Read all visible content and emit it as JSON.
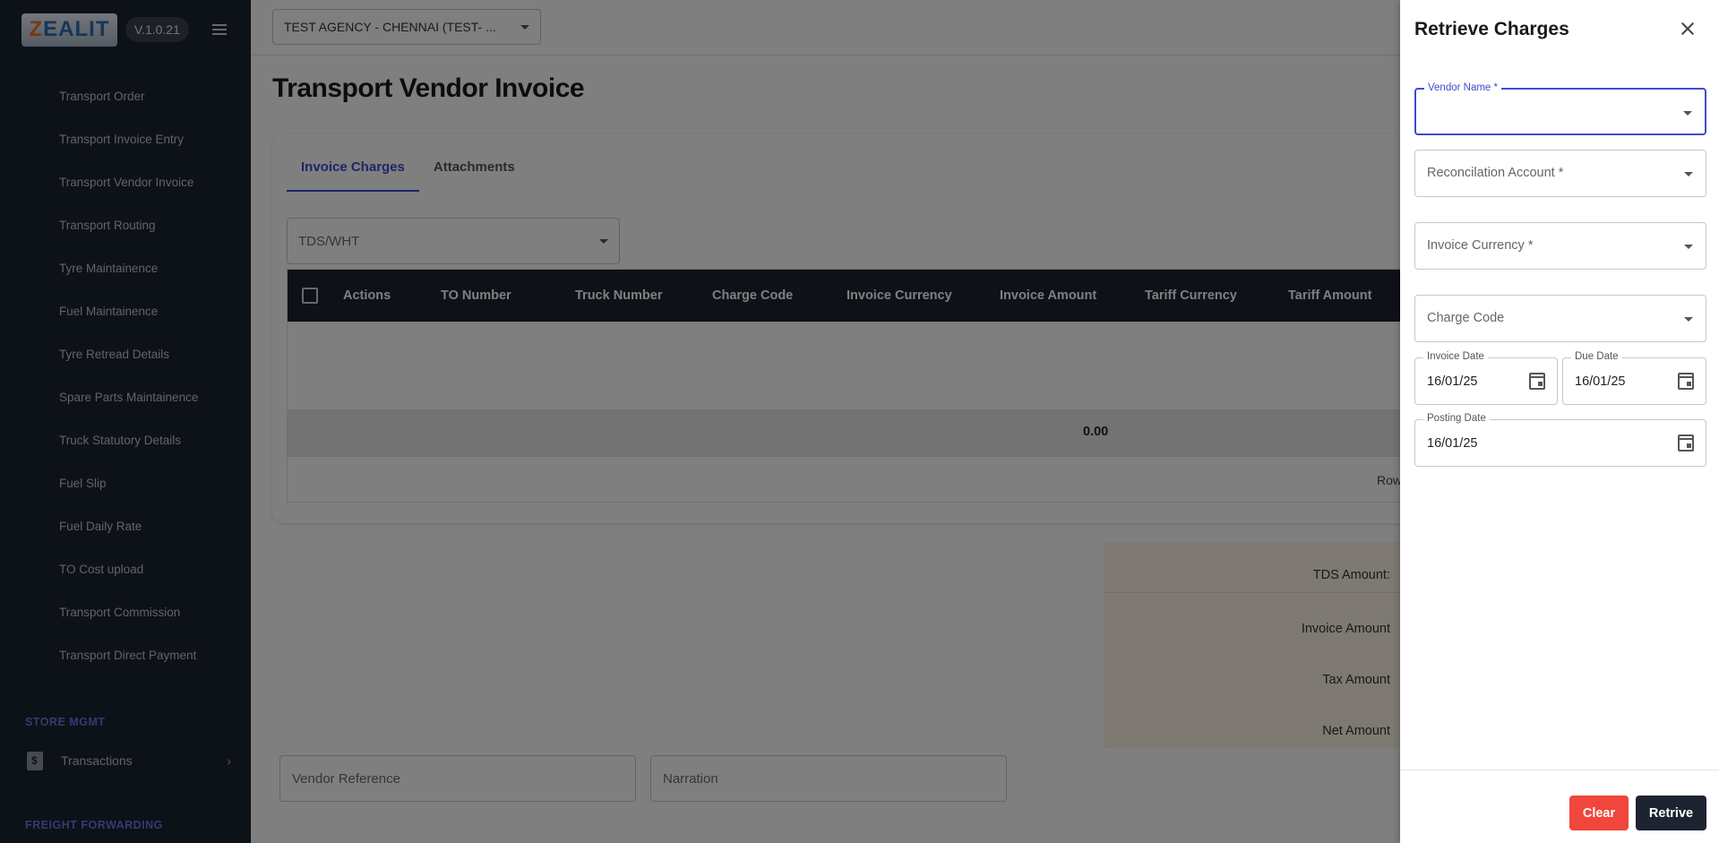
{
  "sidebar": {
    "logo_text": "ZEALIT",
    "version": "V.1.0.21",
    "items": [
      {
        "label": "Transport Order"
      },
      {
        "label": "Transport Invoice Entry"
      },
      {
        "label": "Transport Vendor Invoice"
      },
      {
        "label": "Transport Routing"
      },
      {
        "label": "Tyre Maintainence"
      },
      {
        "label": "Fuel Maintainence"
      },
      {
        "label": "Tyre Retread Details"
      },
      {
        "label": "Spare Parts Maintainence"
      },
      {
        "label": "Truck Statutory Details"
      },
      {
        "label": "Fuel Slip"
      },
      {
        "label": "Fuel Daily Rate"
      },
      {
        "label": "TO Cost upload"
      },
      {
        "label": "Transport Commission"
      },
      {
        "label": "Transport Direct Payment"
      }
    ],
    "section_store": "STORE MGMT",
    "transactions": "Transactions",
    "section_freight": "FREIGHT FORWARDING"
  },
  "topbar": {
    "agency": "TEST AGENCY - CHENNAI  (TEST- ..."
  },
  "page": {
    "title": "Transport Vendor Invoice",
    "tabs": [
      "Invoice Charges",
      "Attachments"
    ],
    "tds_placeholder": "TDS/WHT"
  },
  "grid": {
    "columns": [
      "Actions",
      "TO Number",
      "Truck Number",
      "Charge Code",
      "Invoice Currency",
      "Invoice Amount",
      "Tariff Currency",
      "Tariff Amount"
    ],
    "total_amount": "0.00",
    "rows_label": "Rows"
  },
  "summary": {
    "tds": "TDS Amount:",
    "invoice": "Invoice Amount",
    "tax": "Tax Amount",
    "net": "Net Amount"
  },
  "bottom": {
    "vendor_reference": "Vendor Reference",
    "narration": "Narration"
  },
  "drawer": {
    "title": "Retrieve Charges",
    "vendor_name_label": "Vendor Name *",
    "reconciliation_account": "Reconcilation Account *",
    "invoice_currency": "Invoice Currency *",
    "charge_code": "Charge Code",
    "invoice_date_label": "Invoice Date",
    "invoice_date": "16/01/25",
    "due_date_label": "Due Date",
    "due_date": "16/01/25",
    "posting_date_label": "Posting Date",
    "posting_date": "16/01/25",
    "clear_label": "Clear",
    "retrive_label": "Retrive"
  }
}
